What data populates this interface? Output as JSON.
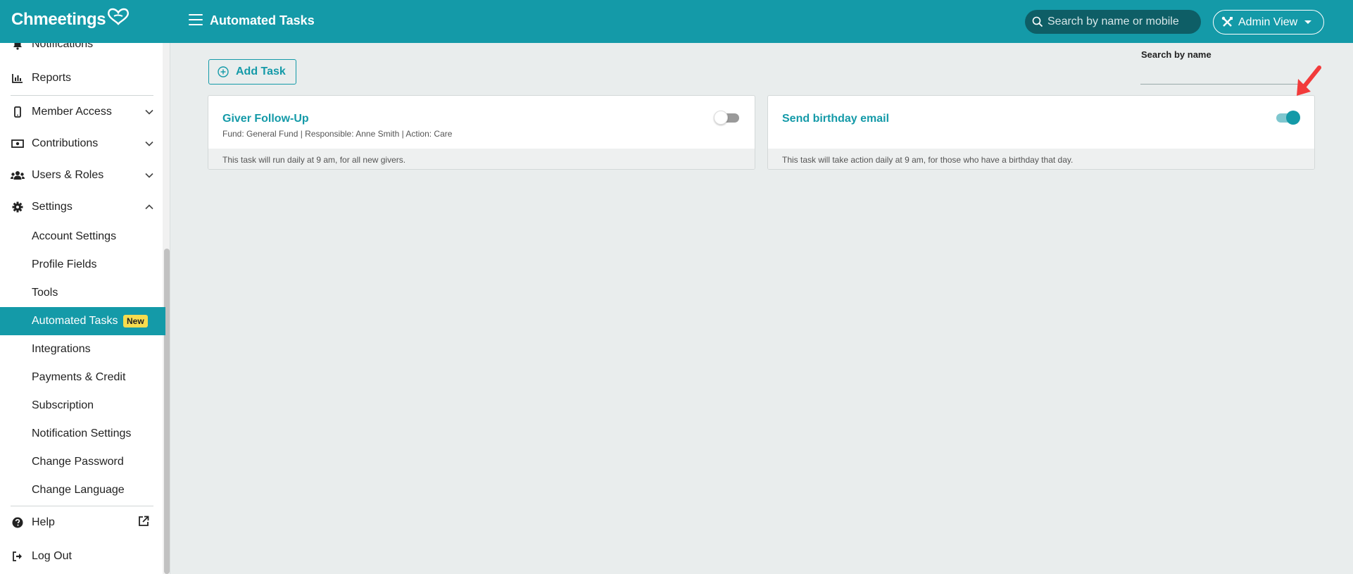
{
  "app": {
    "logo_text": "Chmeetings"
  },
  "header": {
    "title": "Automated Tasks",
    "search_placeholder": "Search by name or mobile",
    "view_label": "Admin View"
  },
  "sidebar": {
    "items": [
      {
        "label": "Notifications",
        "icon": "bell-icon"
      },
      {
        "label": "Reports",
        "icon": "chart-icon"
      },
      {
        "label": "Member Access",
        "icon": "mobile-icon",
        "chevron": "down"
      },
      {
        "label": "Contributions",
        "icon": "money-icon",
        "chevron": "down"
      },
      {
        "label": "Users & Roles",
        "icon": "users-icon",
        "chevron": "down"
      },
      {
        "label": "Settings",
        "icon": "gear-icon",
        "chevron": "up"
      }
    ],
    "settings_items": [
      {
        "label": "Account Settings"
      },
      {
        "label": "Profile Fields"
      },
      {
        "label": "Tools"
      },
      {
        "label": "Automated Tasks",
        "active": true,
        "badge": "New"
      },
      {
        "label": "Integrations"
      },
      {
        "label": "Payments & Credit"
      },
      {
        "label": "Subscription"
      },
      {
        "label": "Notification Settings"
      },
      {
        "label": "Change Password"
      },
      {
        "label": "Change Language"
      }
    ],
    "footer": [
      {
        "label": "Help",
        "icon": "question-icon"
      },
      {
        "label": "Log Out",
        "icon": "logout-icon"
      }
    ]
  },
  "main": {
    "add_task_label": "Add Task",
    "search_label": "Search by name",
    "tasks": [
      {
        "title": "Giver Follow-Up",
        "details": "Fund: General Fund | Responsible: Anne Smith | Action: Care",
        "footer": "This task will run daily at 9 am, for all new givers.",
        "enabled": false
      },
      {
        "title": "Send birthday email",
        "details": "",
        "footer": "This task will take action daily at 9 am, for those who have a birthday that day.",
        "enabled": true
      }
    ]
  },
  "colors": {
    "brand": "#149aa8",
    "badge": "#f7dc4e",
    "annotation_arrow": "#f23b3b"
  }
}
